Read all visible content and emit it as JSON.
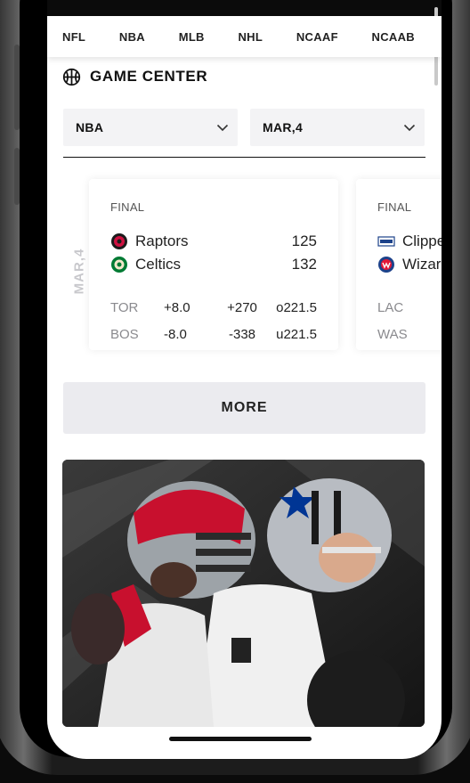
{
  "nav": {
    "leagues": [
      "NFL",
      "NBA",
      "MLB",
      "NHL",
      "NCAAF",
      "NCAAB"
    ]
  },
  "game_center": {
    "title": "GAME CENTER"
  },
  "filters": {
    "league_value": "NBA",
    "date_value": "MAR,4"
  },
  "date_label": "MAR,4",
  "games": [
    {
      "status": "FINAL",
      "away": {
        "name": "Raptors",
        "abbr": "TOR",
        "score": "125",
        "spread": "+8.0",
        "moneyline": "+270",
        "total": "o221.5"
      },
      "home": {
        "name": "Celtics",
        "abbr": "BOS",
        "score": "132",
        "spread": "-8.0",
        "moneyline": "-338",
        "total": "u221.5"
      }
    },
    {
      "status": "FINAL",
      "away": {
        "name": "Clippers",
        "abbr": "LAC"
      },
      "home": {
        "name": "Wizards",
        "abbr": "WAS"
      }
    }
  ],
  "more_button": {
    "label": "MORE"
  },
  "colors": {
    "raptors_red": "#ce1141",
    "celtics_green": "#007a33",
    "clippers_blue": "#1d428a",
    "wizards_red": "#e31837"
  }
}
